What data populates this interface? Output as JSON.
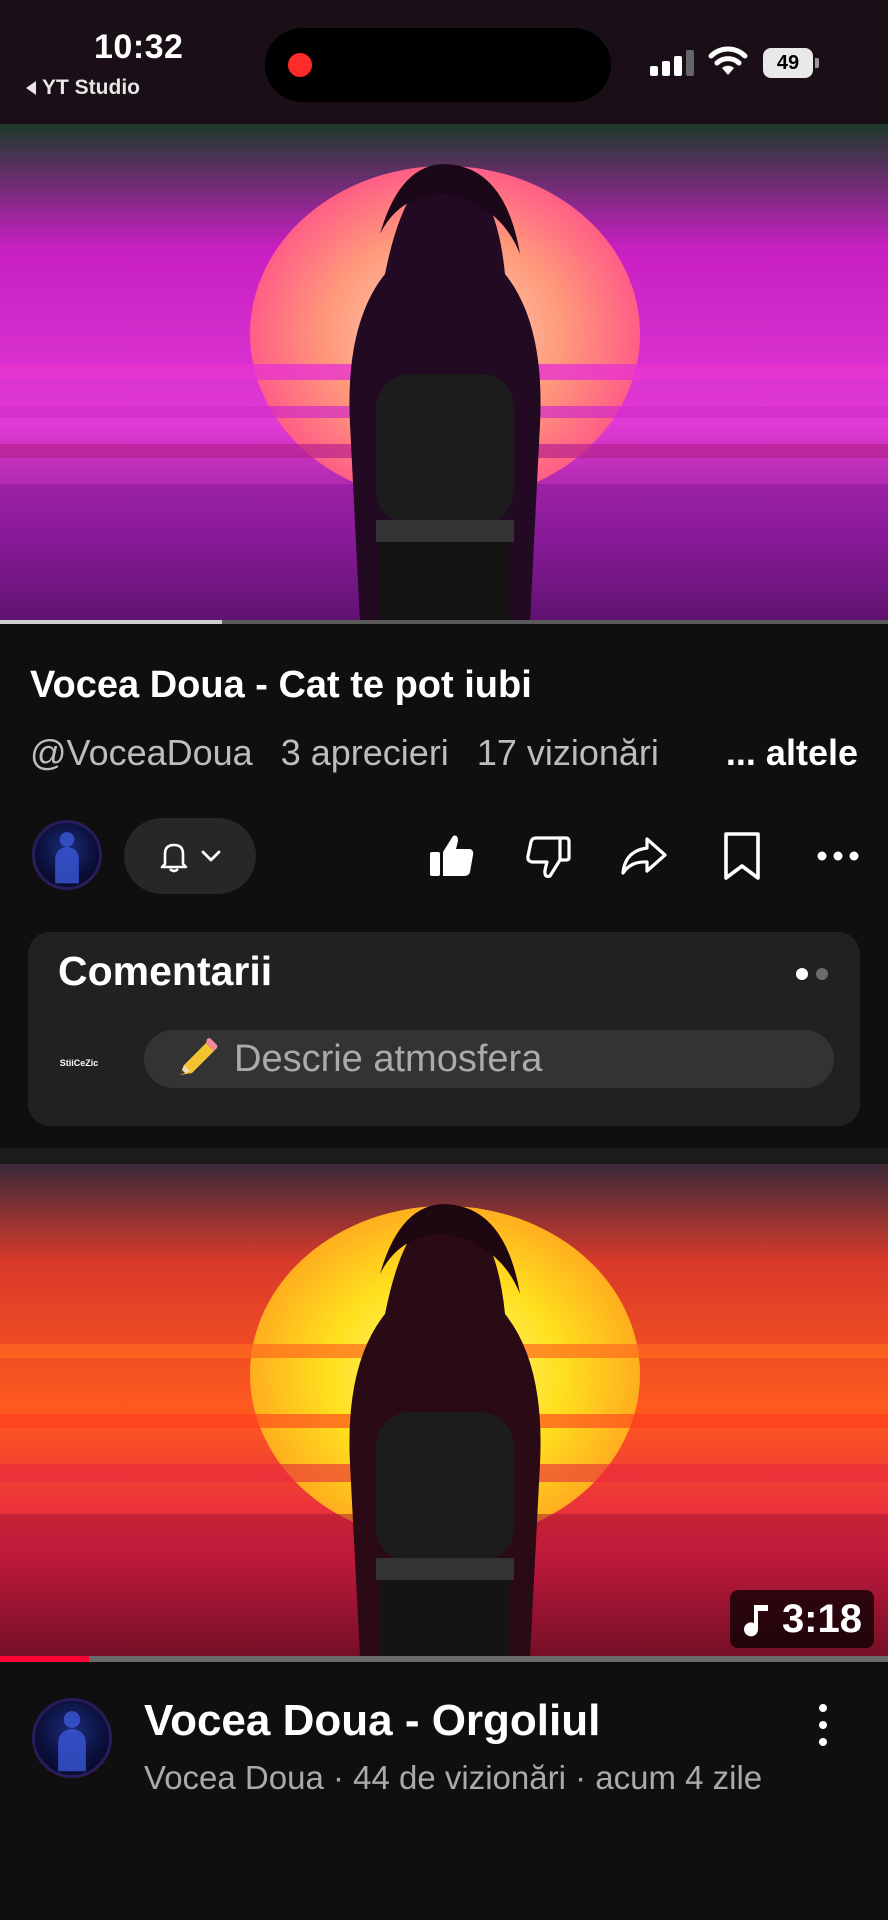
{
  "status_bar": {
    "time": "10:32",
    "back_app": "YT Studio",
    "battery": "49",
    "icons": [
      "signal-icon",
      "wifi-icon",
      "battery-icon"
    ],
    "recording_color": "#ff2b2b"
  },
  "video_player": {
    "title": "Vocea Doua - Cat te pot iubi",
    "channel_handle": "@VoceaDoua",
    "likes": "3 aprecieri",
    "views": "17 vizionări",
    "more_label": "... altele",
    "progress": 0.25
  },
  "actions": {
    "icons": [
      "bell-icon",
      "chevron-down-icon",
      "like-icon",
      "dislike-icon",
      "share-icon",
      "save-icon",
      "more-icon"
    ],
    "like_active": true
  },
  "comments": {
    "title": "Comentarii",
    "channel_logo": "StiiCeZic",
    "input_placeholder": "Descrie atmosfera",
    "input_icon": "pencil-icon",
    "pager_active": 0,
    "pager_count": 2
  },
  "next_video": {
    "duration": "3:18",
    "duration_icon": "music-note-icon",
    "title": "Vocea Doua - Orgoliul",
    "meta": "Vocea Doua · 44 de vizionări · acum 4 zile",
    "progress": 0.1,
    "progress_color": "#ff0033"
  }
}
